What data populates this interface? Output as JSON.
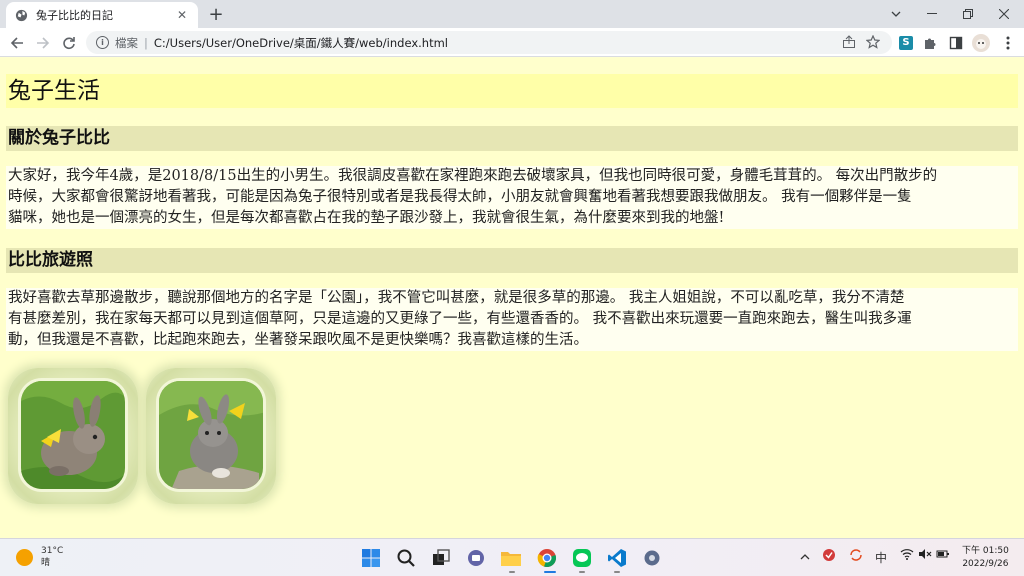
{
  "browser": {
    "tab_title": "兔子比比的日記",
    "tab_close": "✕",
    "new_tab": "+",
    "scheme_label": "檔案",
    "separator": "|",
    "url": "C:/Users/User/OneDrive/桌面/鐵人賽/web/index.html",
    "extension_label": "S"
  },
  "page": {
    "title": "兔子生活",
    "sections": [
      {
        "heading": "關於兔子比比",
        "lines": [
          "大家好，我今年4歲，是2018/8/15出生的小男生。我很調皮喜歡在家裡跑來跑去破壞家具，但我也同時很可愛，身體毛茸茸的。 每次出門散步的",
          "時候，大家都會很驚訝地看著我，可能是因為兔子很特別或者是我長得太帥，小朋友就會興奮地看著我想要跟我做朋友。 我有一個夥伴是一隻",
          "貓咪，她也是一個漂亮的女生，但是每次都喜歡占在我的墊子跟沙發上，我就會很生氣，為什麼要來到我的地盤!"
        ]
      },
      {
        "heading": "比比旅遊照",
        "lines": [
          "我好喜歡去草那邊散步，聽說那個地方的名字是「公園」，我不管它叫甚麼，就是很多草的那邊。 我主人姐姐說，不可以亂吃草，我分不清楚",
          "有甚麼差別，我在家每天都可以見到這個草阿，只是這邊的又更綠了一些，有些還香香的。 我不喜歡出來玩還要一直跑來跑去，醫生叫我多運",
          "動，但我還是不喜歡，比起跑來跑去，坐著發呆跟吹風不是更快樂嗎？我喜歡這樣的生活。"
        ]
      }
    ]
  },
  "taskbar": {
    "weather_temp": "31°C",
    "weather_desc": "晴",
    "ime": "中",
    "time": "下午 01:50",
    "date": "2022/9/26"
  }
}
